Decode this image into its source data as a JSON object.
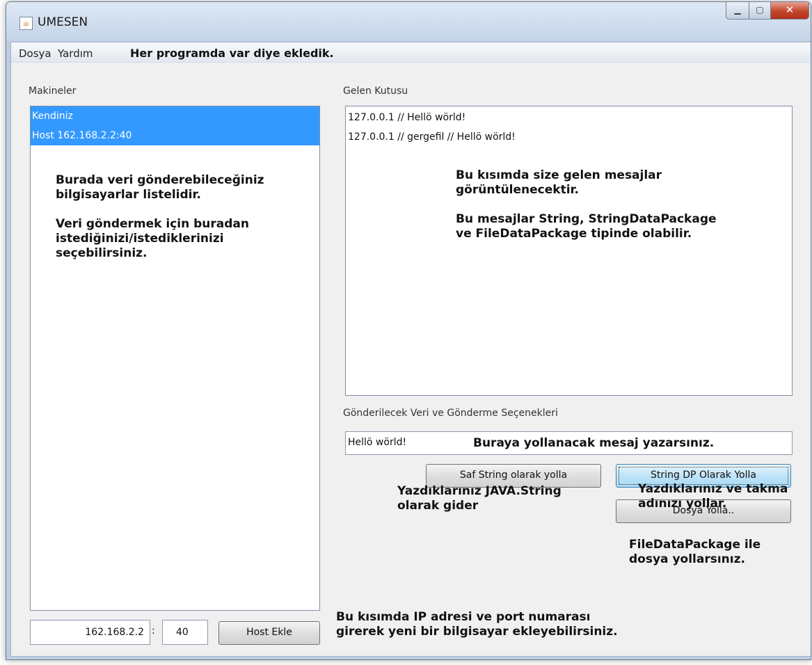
{
  "window": {
    "title": "UMESEN"
  },
  "menu": {
    "items": [
      "Dosya",
      "Yardım"
    ],
    "note": "Her programda var diye ekledik."
  },
  "machines": {
    "label": "Makineler",
    "items": [
      "Kendiniz",
      "Host 162.168.2.2:40"
    ],
    "note": "Burada veri gönderebileceğiniz\nbilgisayarlar listelidir.\n\nVeri göndermek için buradan\nistediğinizi/istediklerinizi\nseçebilirsiniz."
  },
  "inbox": {
    "label": "Gelen Kutusu",
    "messages": [
      "127.0.0.1 // Hellö wörld!",
      "127.0.0.1 // gergefil // Hellö wörld!"
    ],
    "note": "Bu kısımda size gelen mesajlar\ngörüntülenecektir.\n\nBu mesajlar String, StringDataPackage\nve FileDataPackage tipinde olabilir."
  },
  "send": {
    "label": "Gönderilecek Veri ve Gönderme Seçenekleri",
    "input_value": "Hellö wörld!",
    "input_note": "Buraya yollanacak mesaj yazarsınız.",
    "btn_raw": "Saf String olarak yolla",
    "btn_raw_note": "Yazdıklarınız JAVA.String\nolarak gider",
    "btn_dp": "String DP Olarak Yolla",
    "btn_dp_note": "Yazdıklarınız ve takma\nadınızı yollar.",
    "btn_file": "Dosya Yolla..",
    "btn_file_note": "FileDataPackage ile\ndosya yollarsınız."
  },
  "host": {
    "ip_value": "162.168.2.2",
    "separator": ":",
    "port_value": "40",
    "add_button": "Host Ekle",
    "note": "Bu kısımda IP adresi ve port numarası\ngirerek yeni bir bilgisayar ekleyebilirsiniz."
  }
}
